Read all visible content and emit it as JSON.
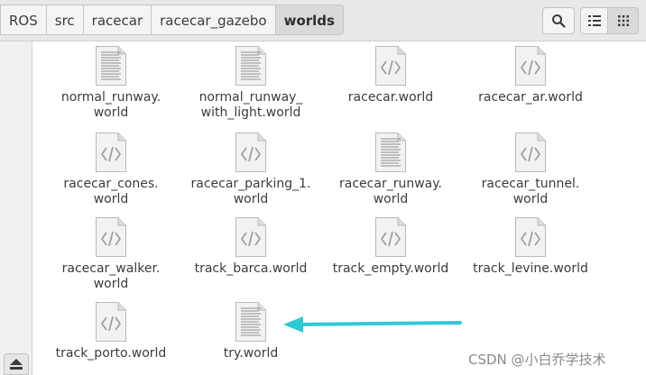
{
  "breadcrumb": [
    "ROS",
    "src",
    "racecar",
    "racecar_gazebo",
    "worlds"
  ],
  "toolbar": {
    "search_icon": "search-icon",
    "list_icon": "list-view-icon",
    "grid_icon": "grid-view-icon"
  },
  "files": [
    {
      "name": "normal_runway.\nworld",
      "icon": "text-document-icon"
    },
    {
      "name": "normal_runway_\nwith_light.world",
      "icon": "text-document-icon"
    },
    {
      "name": "racecar.world",
      "icon": "code-document-icon"
    },
    {
      "name": "racecar_ar.world",
      "icon": "code-document-icon"
    },
    {
      "name": "racecar_cones.\nworld",
      "icon": "code-document-icon"
    },
    {
      "name": "racecar_parking_1.\nworld",
      "icon": "code-document-icon"
    },
    {
      "name": "racecar_runway.\nworld",
      "icon": "text-document-icon"
    },
    {
      "name": "racecar_tunnel.\nworld",
      "icon": "code-document-icon"
    },
    {
      "name": "racecar_walker.\nworld",
      "icon": "code-document-icon"
    },
    {
      "name": "track_barca.world",
      "icon": "code-document-icon"
    },
    {
      "name": "track_empty.world",
      "icon": "code-document-icon"
    },
    {
      "name": "track_levine.world",
      "icon": "code-document-icon"
    },
    {
      "name": "track_porto.world",
      "icon": "code-document-icon"
    },
    {
      "name": "try.world",
      "icon": "text-document-icon"
    }
  ],
  "colors": {
    "annotation_arrow": "#2fc9d6"
  },
  "watermark": "CSDN @小白乔学技术"
}
